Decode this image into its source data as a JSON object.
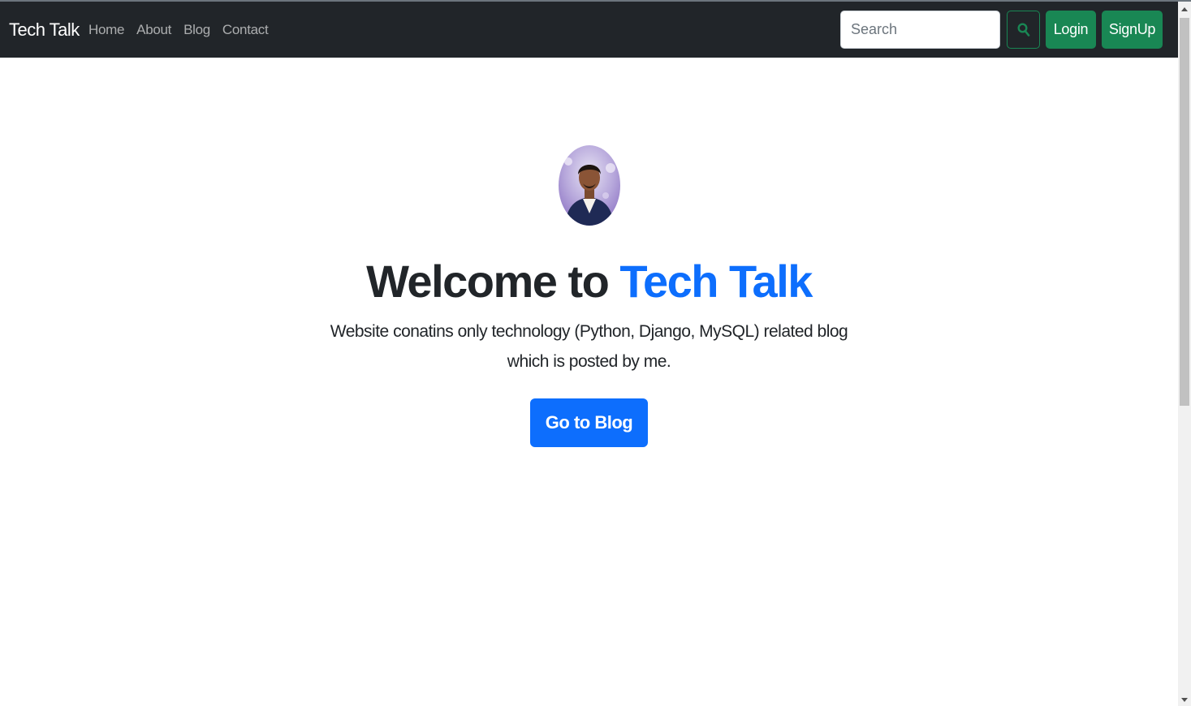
{
  "navbar": {
    "brand": "Tech Talk",
    "links": [
      "Home",
      "About",
      "Blog",
      "Contact"
    ],
    "search_placeholder": "Search",
    "search_icon": "search-icon",
    "login_label": "Login",
    "signup_label": "SignUp",
    "bg_color": "#212529",
    "button_color": "#198754"
  },
  "hero": {
    "title_prefix": "Welcome to ",
    "title_accent": "Tech Talk",
    "lead": "Website conatins only technology (Python, Django, MySQL) related blog which is posted by me.",
    "cta_label": "Go to Blog",
    "accent_color": "#0d6efd"
  }
}
